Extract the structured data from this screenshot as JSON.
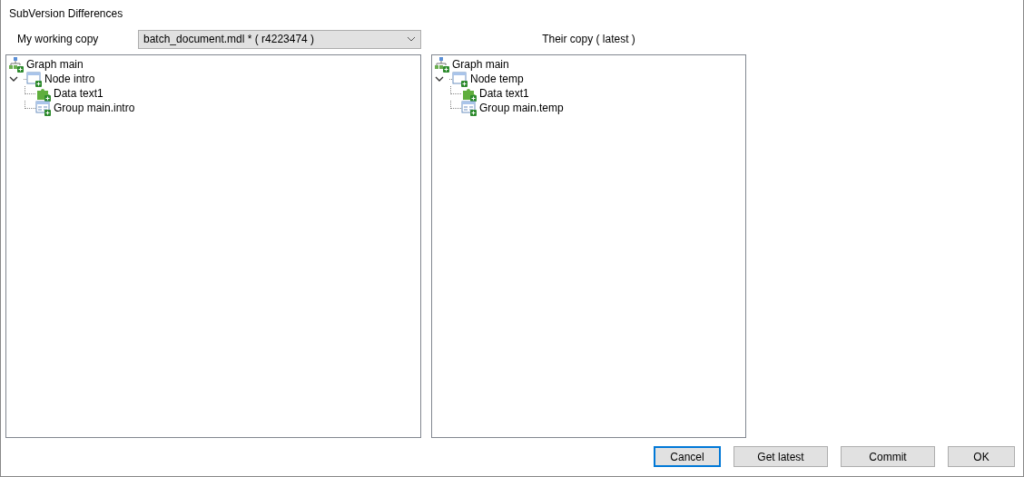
{
  "window": {
    "title": "SubVersion Differences"
  },
  "working_copy": {
    "label": "My working copy",
    "value": "batch_document.mdl * ( r4223474 )"
  },
  "their_copy": {
    "label": "Their copy ( latest )"
  },
  "left_tree": [
    {
      "kind": "graph",
      "label": "Graph main"
    },
    {
      "kind": "node",
      "label": "Node intro",
      "expanded": true,
      "children": [
        {
          "kind": "data",
          "label": "Data text1"
        },
        {
          "kind": "group",
          "label": "Group main.intro"
        }
      ]
    }
  ],
  "right_tree": [
    {
      "kind": "graph",
      "label": "Graph main"
    },
    {
      "kind": "node",
      "label": "Node temp",
      "expanded": true,
      "children": [
        {
          "kind": "data",
          "label": "Data text1"
        },
        {
          "kind": "group",
          "label": "Group main.temp"
        }
      ]
    }
  ],
  "buttons": [
    {
      "label": "Cancel",
      "focused": true
    },
    {
      "label": "Get latest",
      "focused": false
    },
    {
      "label": "Commit",
      "focused": false
    },
    {
      "label": "OK",
      "focused": false
    }
  ]
}
